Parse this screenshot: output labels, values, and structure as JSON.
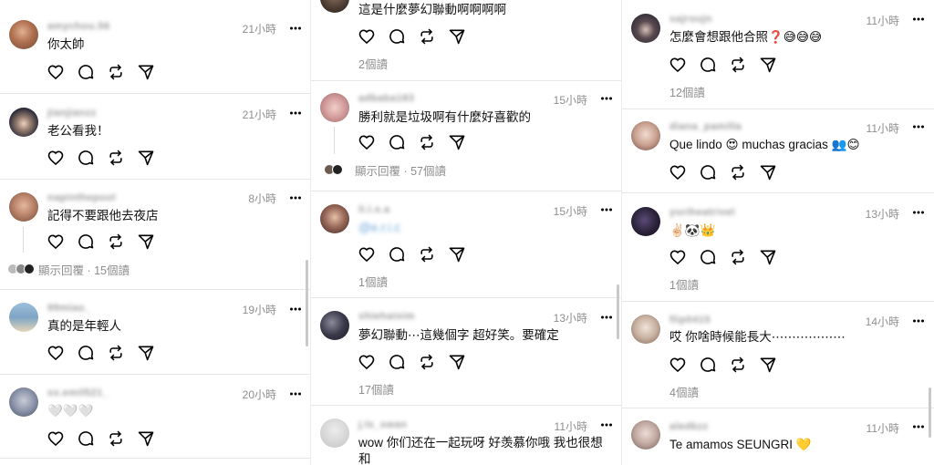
{
  "read_unit": "個讀",
  "show_replies": "顯示回覆",
  "columns": [
    {
      "comments": [
        {
          "username": "amychou.56",
          "time": "21小時",
          "text": "你太帥",
          "avatar_color": "#c98a6a"
        },
        {
          "username": "jianjianzz",
          "time": "21小時",
          "text": "老公看我！",
          "avatar_color": "#2a2a3a"
        },
        {
          "username": "napinthepool",
          "time": "8小時",
          "text": "記得不要跟他去夜店",
          "avatar_color": "#b07a5e",
          "replies": "顯示回覆 · 15個讀"
        },
        {
          "username": "99miao_",
          "time": "19小時",
          "text": "真的是年輕人",
          "avatar_color": "#7fa6c4"
        },
        {
          "username": "xx.emil521_",
          "time": "20小時",
          "text": "🤍🤍🤍",
          "avatar_color": "#8a93a8"
        }
      ]
    },
    {
      "comments": [
        {
          "text": "這是什麼夢幻聯動啊啊啊啊",
          "reads": "2個讀",
          "avatar_color": "#4a3a30"
        },
        {
          "username": "adbaba183",
          "time": "15小時",
          "text": "勝利就是垃圾啊有什麼好喜歡的",
          "avatar_color": "#d6a0a0",
          "replies": "顯示回覆 · 57個讀"
        },
        {
          "username": "li.i.s.a",
          "time": "15小時",
          "text": "@e.r.i.c",
          "avatar_color": "#9a6a5a",
          "reads": "1個讀"
        },
        {
          "username": "shiehaisim",
          "time": "13小時",
          "text": "夢幻聯動⋯這幾個字 超好笑。要確定",
          "avatar_color": "#3a3a4a",
          "reads": "17個讀"
        },
        {
          "username": "j.ls_swan",
          "time": "11小時",
          "text": "wow 你们还在一起玩呀 好羡慕你哦 我也很想和\n胜利拍照",
          "avatar_color": "#d8d8d8"
        }
      ]
    },
    {
      "comments": [
        {
          "username": "sajroujn",
          "time": "11小時",
          "text": "怎麼會想跟他合照❓😅😅😅",
          "avatar_color": "#2c2c3c",
          "reads": "12個讀"
        },
        {
          "username": "diana_pamilla",
          "time": "11小時",
          "text": "Que lindo 😍 muchas gracias 👥😊",
          "avatar_color": "#c9a090"
        },
        {
          "username": "yuriheatrivel",
          "time": "13小時",
          "text": "✌🏻🐼👑",
          "avatar_color": "#2a2238",
          "reads": "1個讀"
        },
        {
          "username": "flip0415",
          "time": "14小時",
          "text": "哎 你啥時候能長大⋯⋯⋯⋯⋯⋯",
          "avatar_color": "#c8b0a0",
          "reads": "4個讀"
        },
        {
          "username": "aledkzz",
          "time": "11小時",
          "text": "Te amamos SEUNGRI 💛",
          "avatar_color": "#c0a8a0"
        }
      ]
    }
  ]
}
